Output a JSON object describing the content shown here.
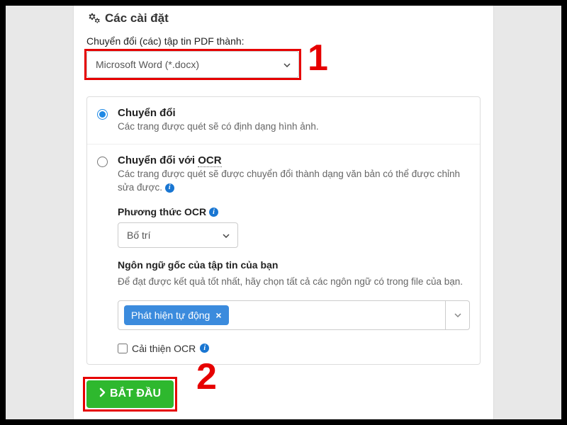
{
  "header": {
    "title": "Các cài đặt"
  },
  "convert": {
    "label": "Chuyển đổi (các) tập tin PDF thành:",
    "selected": "Microsoft Word (*.docx)"
  },
  "options": {
    "basic": {
      "title": "Chuyển đổi",
      "desc": "Các trang được quét sẽ có định dạng hình ảnh."
    },
    "ocr": {
      "title_pre": "Chuyển đổi với ",
      "title_term": "OCR",
      "desc": "Các trang được quét sẽ được chuyển đổi thành dạng văn bản có thể được chỉnh sửa được.",
      "method_label": "Phương thức OCR",
      "method_selected": "Bố trí",
      "lang_label": "Ngôn ngữ gốc của tập tin của bạn",
      "lang_help": "Để đạt được kết quả tốt nhất, hãy chọn tất cả các ngôn ngữ có trong file của bạn.",
      "lang_tag": "Phát hiện tự động",
      "improve_label": "Cải thiện OCR"
    }
  },
  "start_label": "BẮT ĐẦU",
  "annotations": {
    "one": "1",
    "two": "2"
  }
}
